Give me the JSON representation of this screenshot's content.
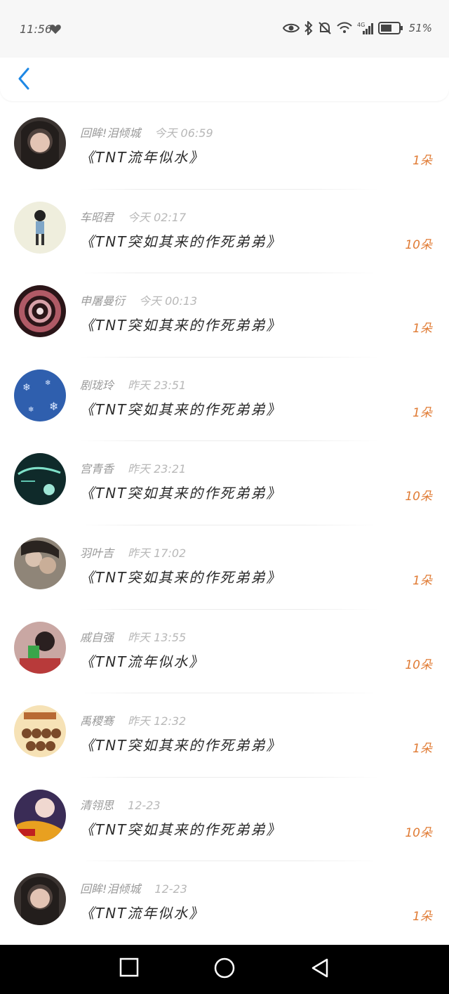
{
  "status_bar": {
    "time": "11:56",
    "battery_percent": "51%",
    "network": "4G"
  },
  "header": {
    "back_icon": "chevron-left-icon",
    "accent_color": "#1e88e5"
  },
  "messages": [
    {
      "sender": "回眸!泪倾城",
      "date": "今天 06:59",
      "title": "《TNT流年似水》",
      "count": "1朵"
    },
    {
      "sender": "车昭君",
      "date": "今天 02:17",
      "title": "《TNT突如其来的作死弟弟》",
      "count": "10朵"
    },
    {
      "sender": "申屠曼衍",
      "date": "今天 00:13",
      "title": "《TNT突如其来的作死弟弟》",
      "count": "1朵"
    },
    {
      "sender": "剧珑玲",
      "date": "昨天 23:51",
      "title": "《TNT突如其来的作死弟弟》",
      "count": "1朵"
    },
    {
      "sender": "宫青香",
      "date": "昨天 23:21",
      "title": "《TNT突如其来的作死弟弟》",
      "count": "10朵"
    },
    {
      "sender": "羽叶吉",
      "date": "昨天 17:02",
      "title": "《TNT突如其来的作死弟弟》",
      "count": "1朵"
    },
    {
      "sender": "戚自强",
      "date": "昨天 13:55",
      "title": "《TNT流年似水》",
      "count": "10朵"
    },
    {
      "sender": "禹稷骞",
      "date": "昨天 12:32",
      "title": "《TNT突如其来的作死弟弟》",
      "count": "1朵"
    },
    {
      "sender": "清翎思",
      "date": "12-23",
      "title": "《TNT突如其来的作死弟弟》",
      "count": "10朵"
    },
    {
      "sender": "回眸!泪倾城",
      "date": "12-23",
      "title": "《TNT流年似水》",
      "count": "1朵"
    }
  ],
  "colors": {
    "count_color": "#e07b34",
    "sender_color": "#9a9a9a",
    "title_color": "#2b2b2b"
  },
  "bottom_nav": {
    "icons": [
      "square-icon",
      "circle-icon",
      "triangle-back-icon"
    ]
  }
}
